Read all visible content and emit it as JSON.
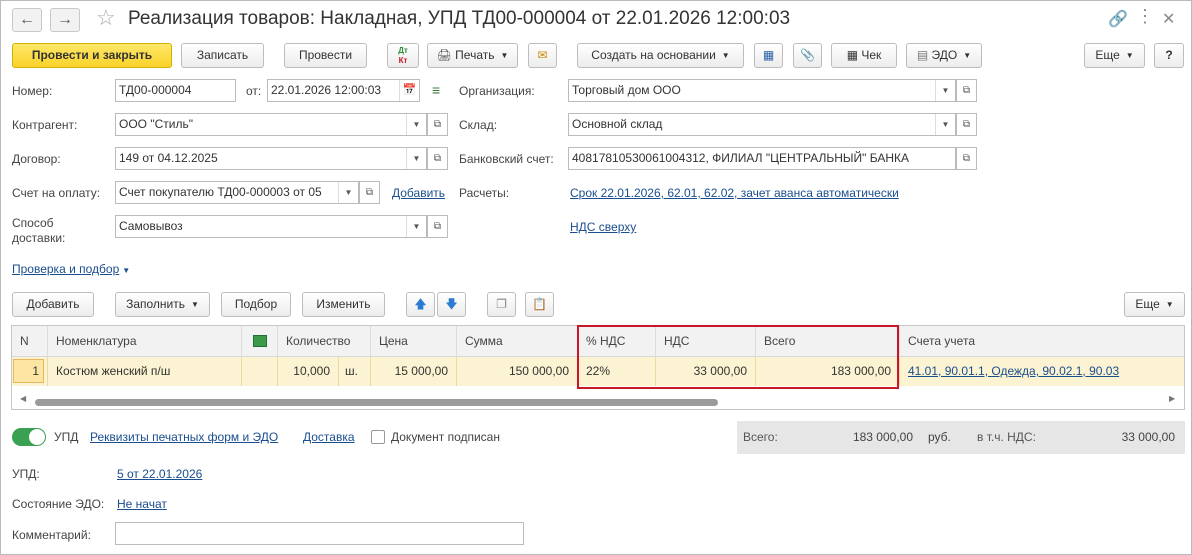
{
  "window": {
    "title": "Реализация товаров: Накладная, УПД ТД00-000004 от 22.01.2026 12:00:03"
  },
  "toolbar": {
    "post_close": "Провести и закрыть",
    "save": "Записать",
    "post": "Провести",
    "dtkt_top": "Дт",
    "dtkt_bottom": "Кт",
    "print": "Печать",
    "create_based": "Создать на основании",
    "check": "Чек",
    "edo": "ЭДО",
    "more": "Еще",
    "help": "?"
  },
  "form": {
    "number_label": "Номер:",
    "number_value": "ТД00-000004",
    "date_label": "от:",
    "date_value": "22.01.2026 12:00:03",
    "org_label": "Организация:",
    "org_value": "Торговый дом ООО",
    "counterparty_label": "Контрагент:",
    "counterparty_value": "ООО \"Стиль\"",
    "warehouse_label": "Склад:",
    "warehouse_value": "Основной склад",
    "contract_label": "Договор:",
    "contract_value": "149 от 04.12.2025",
    "bank_label": "Банковский счет:",
    "bank_value": "40817810530061004312, ФИЛИАЛ \"ЦЕНТРАЛЬНЫЙ\" БАНКА",
    "invoice_label": "Счет на оплату:",
    "invoice_value": "Счет покупателю ТД00-000003 от 05",
    "invoice_add": "Добавить",
    "settlements_label": "Расчеты:",
    "settlements_link": "Срок 22.01.2026, 62.01, 62.02, зачет аванса автоматически",
    "delivery_label_1": "Способ",
    "delivery_label_2": "доставки:",
    "delivery_value": "Самовывоз",
    "vat_link": "НДС сверху",
    "check_select_link": "Проверка и подбор"
  },
  "table_toolbar": {
    "add": "Добавить",
    "fill": "Заполнить",
    "select": "Подбор",
    "change": "Изменить",
    "more": "Еще"
  },
  "table": {
    "headers": {
      "n": "N",
      "nomenclature": "Номенклатура",
      "quantity": "Количество",
      "price": "Цена",
      "sum": "Сумма",
      "vat_rate": "% НДС",
      "vat": "НДС",
      "total": "Всего",
      "accounts": "Счета учета"
    },
    "rows": [
      {
        "n": "1",
        "nomenclature": "Костюм женский п/ш",
        "quantity": "10,000",
        "unit": "ш.",
        "price": "15 000,00",
        "sum": "150 000,00",
        "vat_rate": "22%",
        "vat": "33 000,00",
        "total": "183 000,00",
        "accounts": "41.01, 90.01.1, Одежда, 90.02.1, 90.03"
      }
    ]
  },
  "footer": {
    "upd_toggle_label": "УПД",
    "print_forms_link": "Реквизиты печатных форм и ЭДО",
    "delivery_link": "Доставка",
    "signed_label": "Документ подписан",
    "total_label": "Всего:",
    "total_value": "183 000,00",
    "currency": "руб.",
    "vat_incl_label": "в т.ч. НДС:",
    "vat_incl_value": "33 000,00",
    "upd_label": "УПД:",
    "upd_link": "5 от 22.01.2026",
    "edo_state_label": "Состояние ЭДО:",
    "edo_state_link": "Не начат",
    "comment_label": "Комментарий:",
    "comment_value": ""
  },
  "colors": {
    "primary_button": "#f9d229",
    "selected_row": "#fbf3d2",
    "highlight_border": "#c8172a",
    "link": "#1a4e8f",
    "toggle_on": "#3aa052"
  }
}
